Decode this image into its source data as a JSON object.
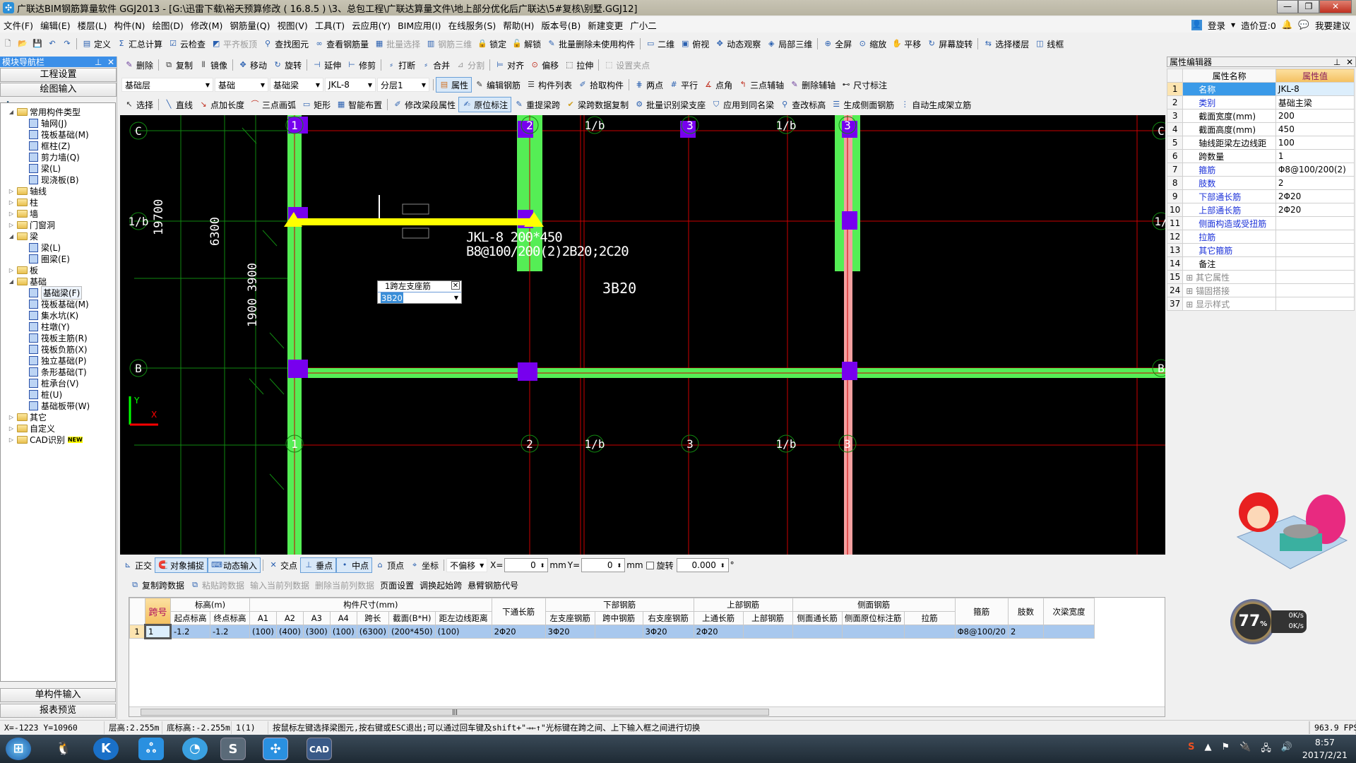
{
  "window": {
    "title": "广联达BIM钢筋算量软件 GGJ2013 - [G:\\迅雷下载\\裕天预算修改 ( 16.8.5 ) \\3、总包工程\\广联达算量文件\\地上部分优化后广联达\\5#复核\\别墅.GGJ12]",
    "app_icon": "glodon-icon"
  },
  "menu": {
    "items": [
      "文件(F)",
      "编辑(E)",
      "楼层(L)",
      "构件(N)",
      "绘图(D)",
      "修改(M)",
      "钢筋量(Q)",
      "视图(V)",
      "工具(T)",
      "云应用(Y)",
      "BIM应用(I)",
      "在线服务(S)",
      "帮助(H)",
      "版本号(B)",
      "新建变更",
      "广小二"
    ],
    "login": "登录",
    "coins": "造价豆:0",
    "suggest": "我要建议"
  },
  "toolbar1": [
    "定义",
    "汇总计算",
    "云检查",
    "平齐板顶",
    "查找图元",
    "查看钢筋量",
    "批量选择",
    "钢筋三维",
    "锁定",
    "解锁",
    "批量删除未使用构件",
    "二维",
    "俯视",
    "动态观察",
    "局部三维",
    "全屏",
    "缩放",
    "平移",
    "屏幕旋转",
    "选择楼层",
    "线框"
  ],
  "toolbar2": [
    "删除",
    "复制",
    "镜像",
    "移动",
    "旋转",
    "延伸",
    "修剪",
    "打断",
    "合并",
    "分割",
    "对齐",
    "偏移",
    "拉伸",
    "设置夹点"
  ],
  "toolbar3": {
    "combos": [
      "基础层",
      "基础",
      "基础梁",
      "JKL-8",
      "分层1"
    ],
    "buttons": [
      "属性",
      "编辑钢筋",
      "构件列表",
      "拾取构件",
      "两点",
      "平行",
      "点角",
      "三点辅轴",
      "删除辅轴",
      "尺寸标注"
    ]
  },
  "toolbar4": [
    "选择",
    "直线",
    "点加长度",
    "三点画弧",
    "矩形",
    "智能布置",
    "修改梁段属性",
    "原位标注",
    "重提梁跨",
    "梁跨数据复制",
    "批量识别梁支座",
    "应用到同名梁",
    "查改标高",
    "生成侧面钢筋",
    "自动生成架立筋"
  ],
  "nav": {
    "title": "模块导航栏",
    "top_buttons": [
      "工程设置",
      "绘图输入"
    ],
    "bottom_buttons": [
      "单构件输入",
      "报表预览"
    ],
    "tree": [
      {
        "label": "常用构件类型",
        "level": 0,
        "type": "folder-open"
      },
      {
        "label": "轴网(J)",
        "level": 1,
        "type": "item"
      },
      {
        "label": "筏板基础(M)",
        "level": 1,
        "type": "item"
      },
      {
        "label": "框柱(Z)",
        "level": 1,
        "type": "item"
      },
      {
        "label": "剪力墙(Q)",
        "level": 1,
        "type": "item"
      },
      {
        "label": "梁(L)",
        "level": 1,
        "type": "item"
      },
      {
        "label": "现浇板(B)",
        "level": 1,
        "type": "item"
      },
      {
        "label": "轴线",
        "level": 0,
        "type": "folder"
      },
      {
        "label": "柱",
        "level": 0,
        "type": "folder"
      },
      {
        "label": "墙",
        "level": 0,
        "type": "folder"
      },
      {
        "label": "门窗洞",
        "level": 0,
        "type": "folder"
      },
      {
        "label": "梁",
        "level": 0,
        "type": "folder-open"
      },
      {
        "label": "梁(L)",
        "level": 1,
        "type": "item"
      },
      {
        "label": "圈梁(E)",
        "level": 1,
        "type": "item"
      },
      {
        "label": "板",
        "level": 0,
        "type": "folder"
      },
      {
        "label": "基础",
        "level": 0,
        "type": "folder-open"
      },
      {
        "label": "基础梁(F)",
        "level": 1,
        "type": "item",
        "selected": true
      },
      {
        "label": "筏板基础(M)",
        "level": 1,
        "type": "item"
      },
      {
        "label": "集水坑(K)",
        "level": 1,
        "type": "item"
      },
      {
        "label": "柱墩(Y)",
        "level": 1,
        "type": "item"
      },
      {
        "label": "筏板主筋(R)",
        "level": 1,
        "type": "item"
      },
      {
        "label": "筏板负筋(X)",
        "level": 1,
        "type": "item"
      },
      {
        "label": "独立基础(P)",
        "level": 1,
        "type": "item"
      },
      {
        "label": "条形基础(T)",
        "level": 1,
        "type": "item"
      },
      {
        "label": "桩承台(V)",
        "level": 1,
        "type": "item"
      },
      {
        "label": "桩(U)",
        "level": 1,
        "type": "item"
      },
      {
        "label": "基础板带(W)",
        "level": 1,
        "type": "item"
      },
      {
        "label": "其它",
        "level": 0,
        "type": "folder"
      },
      {
        "label": "自定义",
        "level": 0,
        "type": "folder"
      },
      {
        "label": "CAD识别",
        "level": 0,
        "type": "folder",
        "badge": "NEW"
      }
    ]
  },
  "canvas": {
    "beam_label_line1": "JKL-8 200*450",
    "beam_label_line2": "B8@100/200(2)2B20;2C20",
    "support_label": "3B20",
    "popup_title": "1跨左支座筋",
    "popup_value": "3B20",
    "axis_top": [
      "1",
      "2",
      "1/b",
      "3",
      "1/b",
      "3"
    ],
    "axis_bottom": [
      "1",
      "2",
      "1/b",
      "3",
      "1/b",
      "3"
    ],
    "axis_left": [
      "C",
      "1/b",
      "B"
    ],
    "dims": [
      "19700",
      "6300",
      "3900",
      "1900"
    ],
    "ucs_x": "X",
    "ucs_y": "Y",
    "colors": {
      "beam": "#55ee55",
      "column": "#7700ee",
      "selected": "#ffff00",
      "axis_red": "#cc0000",
      "axis_green": "#118811"
    }
  },
  "props": {
    "title": "属性编辑器",
    "col_name": "属性名称",
    "col_value": "属性值",
    "rows": [
      {
        "n": "1",
        "name": "名称",
        "value": "JKL-8",
        "style": "sel"
      },
      {
        "n": "2",
        "name": "类别",
        "value": "基础主梁",
        "style": "blue"
      },
      {
        "n": "3",
        "name": "截面宽度(mm)",
        "value": "200",
        "style": ""
      },
      {
        "n": "4",
        "name": "截面高度(mm)",
        "value": "450",
        "style": ""
      },
      {
        "n": "5",
        "name": "轴线距梁左边线距",
        "value": "100",
        "style": ""
      },
      {
        "n": "6",
        "name": "跨数量",
        "value": "1",
        "style": ""
      },
      {
        "n": "7",
        "name": "箍筋",
        "value": "Φ8@100/200(2)",
        "style": "blue"
      },
      {
        "n": "8",
        "name": "肢数",
        "value": "2",
        "style": "blue"
      },
      {
        "n": "9",
        "name": "下部通长筋",
        "value": "2Φ20",
        "style": "blue"
      },
      {
        "n": "10",
        "name": "上部通长筋",
        "value": "2Φ20",
        "style": "blue"
      },
      {
        "n": "11",
        "name": "侧面构造或受扭筋",
        "value": "",
        "style": "blue"
      },
      {
        "n": "12",
        "name": "拉筋",
        "value": "",
        "style": "blue"
      },
      {
        "n": "13",
        "name": "其它箍筋",
        "value": "",
        "style": "blue"
      },
      {
        "n": "14",
        "name": "备注",
        "value": "",
        "style": ""
      },
      {
        "n": "15",
        "name": "其它属性",
        "value": "",
        "style": "gray",
        "expand": true
      },
      {
        "n": "24",
        "name": "锚固搭接",
        "value": "",
        "style": "gray",
        "expand": true
      },
      {
        "n": "37",
        "name": "显示样式",
        "value": "",
        "style": "gray",
        "expand": true
      }
    ]
  },
  "widgets": {
    "cpu_percent": "77",
    "net_up": "0K/s",
    "net_down": "0K/s"
  },
  "snapbar": {
    "buttons": [
      "正交",
      "对象捕捉",
      "动态输入",
      "交点",
      "垂点",
      "中点",
      "顶点",
      "坐标"
    ],
    "offset_mode": "不偏移",
    "x_label": "X=",
    "x_value": "0",
    "unit": "mm",
    "y_label": "Y=",
    "y_value": "0",
    "rotate_label": "旋转",
    "rotate_value": "0.000",
    "degree": "°"
  },
  "spanbar": [
    "复制跨数据",
    "粘贴跨数据",
    "输入当前列数据",
    "删除当前列数据",
    "页面设置",
    "调换起始跨",
    "悬臂钢筋代号"
  ],
  "span_grid": {
    "groups": {
      "elev": "标高(m)",
      "size": "构件尺寸(mm)",
      "bottom": "下部钢筋",
      "top": "上部钢筋",
      "side": "侧面钢筋"
    },
    "headers": [
      "跨号",
      "起点标高",
      "终点标高",
      "A1",
      "A2",
      "A3",
      "A4",
      "跨长",
      "截面(B*H)",
      "距左边线距离",
      "下通长筋",
      "左支座钢筋",
      "跨中钢筋",
      "右支座钢筋",
      "上通长筋",
      "上部钢筋",
      "侧面通长筋",
      "侧面原位标注筋",
      "拉筋",
      "箍筋",
      "肢数",
      "次梁宽度"
    ],
    "rows": [
      [
        "1",
        "1",
        "-1.2",
        "-1.2",
        "(100)",
        "(400)",
        "(300)",
        "(100)",
        "(6300)",
        "(200*450)",
        "(100)",
        "2Φ20",
        "3Φ20",
        "",
        "3Φ20",
        "2Φ20",
        "",
        "",
        "",
        "",
        "Φ8@100/20",
        "2",
        ""
      ]
    ]
  },
  "status": {
    "coords": "X=-1223 Y=10960",
    "floor_height": "层高:2.255m",
    "bottom_elev": "底标高:-2.255m",
    "count": "1(1)",
    "hint": "按鼠标左键选择梁图元,按右键或ESC退出;可以通过回车键及shift+\"→←↑\"光标键在跨之间、上下输入框之间进行切换",
    "fps": "963.9 FPS"
  },
  "taskbar": {
    "time": "8:57",
    "date": "2017/2/21",
    "apps": [
      "start-orb",
      "qq",
      "kugou",
      "baidu-cloud",
      "browser",
      "sogou",
      "glodon",
      "cad"
    ]
  }
}
